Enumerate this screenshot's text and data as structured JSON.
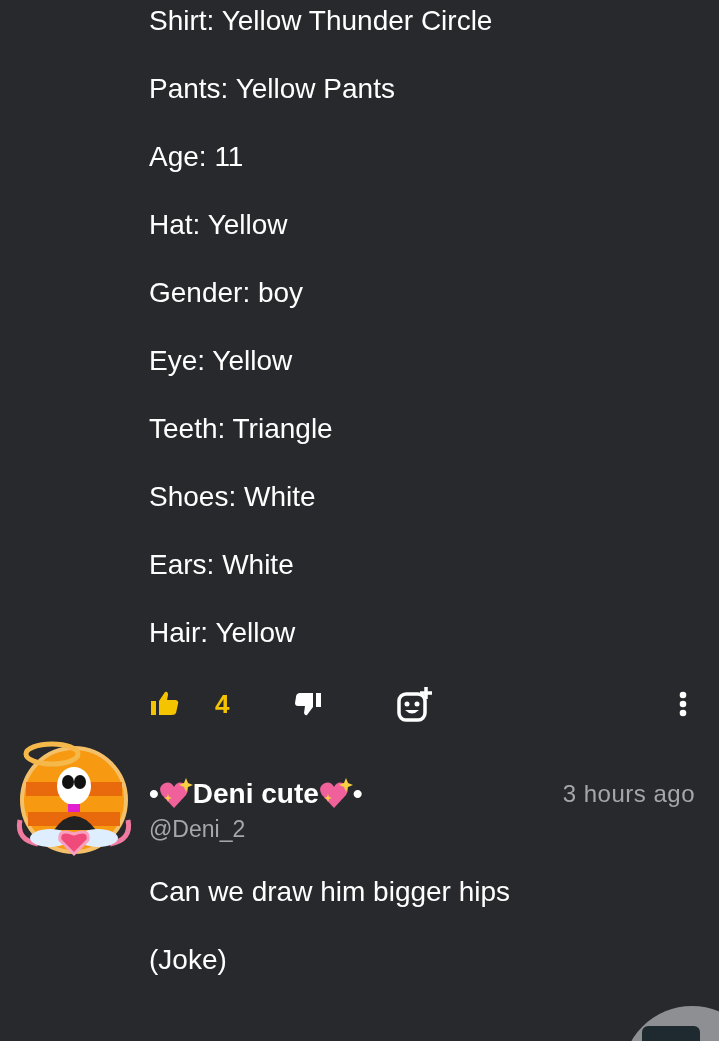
{
  "post_lines": [
    "Shirt: Yellow Thunder Circle",
    "Pants: Yellow Pants",
    "Age: 11",
    "Hat: Yellow",
    "Gender: boy",
    "Eye: Yellow",
    "Teeth: Triangle",
    "Shoes: White",
    "Ears: White",
    "Hair: Yellow"
  ],
  "actions": {
    "liked": true,
    "like_count": "4"
  },
  "comment": {
    "name_prefix": "•",
    "display_name": "Deni cute",
    "name_suffix": "•",
    "handle": "@Deni_2",
    "time": "3 hours ago",
    "lines": [
      "Can we draw him bigger hips",
      "(Joke)"
    ]
  }
}
